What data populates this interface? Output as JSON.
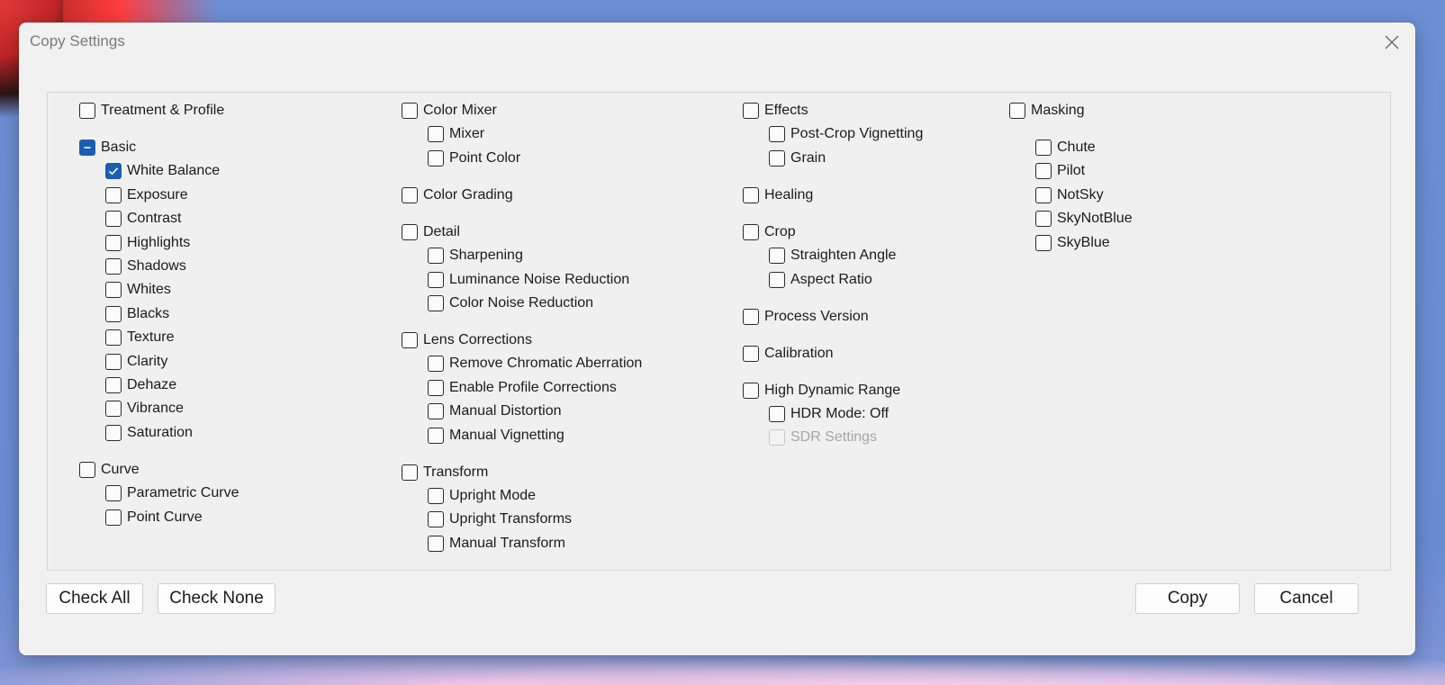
{
  "dialog": {
    "title": "Copy Settings"
  },
  "columns": [
    [
      {
        "label": "Treatment & Profile",
        "level": 0,
        "state": "unchecked",
        "gap": 0
      },
      {
        "label": "Basic",
        "level": 0,
        "state": "mixed",
        "gap": 1
      },
      {
        "label": "White Balance",
        "level": 1,
        "state": "checked"
      },
      {
        "label": "Exposure",
        "level": 1,
        "state": "unchecked"
      },
      {
        "label": "Contrast",
        "level": 1,
        "state": "unchecked"
      },
      {
        "label": "Highlights",
        "level": 1,
        "state": "unchecked"
      },
      {
        "label": "Shadows",
        "level": 1,
        "state": "unchecked"
      },
      {
        "label": "Whites",
        "level": 1,
        "state": "unchecked"
      },
      {
        "label": "Blacks",
        "level": 1,
        "state": "unchecked"
      },
      {
        "label": "Texture",
        "level": 1,
        "state": "unchecked"
      },
      {
        "label": "Clarity",
        "level": 1,
        "state": "unchecked"
      },
      {
        "label": "Dehaze",
        "level": 1,
        "state": "unchecked"
      },
      {
        "label": "Vibrance",
        "level": 1,
        "state": "unchecked"
      },
      {
        "label": "Saturation",
        "level": 1,
        "state": "unchecked"
      },
      {
        "label": "Curve",
        "level": 0,
        "state": "unchecked",
        "gap": 1
      },
      {
        "label": "Parametric Curve",
        "level": 1,
        "state": "unchecked"
      },
      {
        "label": "Point Curve",
        "level": 1,
        "state": "unchecked"
      }
    ],
    [
      {
        "label": "Color Mixer",
        "level": 0,
        "state": "unchecked",
        "gap": 0
      },
      {
        "label": "Mixer",
        "level": 1,
        "state": "unchecked"
      },
      {
        "label": "Point Color",
        "level": 1,
        "state": "unchecked"
      },
      {
        "label": "Color Grading",
        "level": 0,
        "state": "unchecked",
        "gap": 1
      },
      {
        "label": "Detail",
        "level": 0,
        "state": "unchecked",
        "gap": 1
      },
      {
        "label": "Sharpening",
        "level": 1,
        "state": "unchecked"
      },
      {
        "label": "Luminance Noise Reduction",
        "level": 1,
        "state": "unchecked"
      },
      {
        "label": "Color Noise Reduction",
        "level": 1,
        "state": "unchecked"
      },
      {
        "label": "Lens Corrections",
        "level": 0,
        "state": "unchecked",
        "gap": 1
      },
      {
        "label": "Remove Chromatic Aberration",
        "level": 1,
        "state": "unchecked"
      },
      {
        "label": "Enable Profile Corrections",
        "level": 1,
        "state": "unchecked"
      },
      {
        "label": "Manual Distortion",
        "level": 1,
        "state": "unchecked"
      },
      {
        "label": "Manual Vignetting",
        "level": 1,
        "state": "unchecked"
      },
      {
        "label": "Transform",
        "level": 0,
        "state": "unchecked",
        "gap": 1
      },
      {
        "label": "Upright Mode",
        "level": 1,
        "state": "unchecked"
      },
      {
        "label": "Upright Transforms",
        "level": 1,
        "state": "unchecked"
      },
      {
        "label": "Manual Transform",
        "level": 1,
        "state": "unchecked"
      }
    ],
    [
      {
        "label": "Effects",
        "level": 0,
        "state": "unchecked",
        "gap": 0
      },
      {
        "label": "Post-Crop Vignetting",
        "level": 1,
        "state": "unchecked"
      },
      {
        "label": "Grain",
        "level": 1,
        "state": "unchecked"
      },
      {
        "label": "Healing",
        "level": 0,
        "state": "unchecked",
        "gap": 1
      },
      {
        "label": "Crop",
        "level": 0,
        "state": "unchecked",
        "gap": 1
      },
      {
        "label": "Straighten Angle",
        "level": 1,
        "state": "unchecked"
      },
      {
        "label": "Aspect Ratio",
        "level": 1,
        "state": "unchecked"
      },
      {
        "label": "Process Version",
        "level": 0,
        "state": "unchecked",
        "gap": 1
      },
      {
        "label": "Calibration",
        "level": 0,
        "state": "unchecked",
        "gap": 1
      },
      {
        "label": "High Dynamic Range",
        "level": 0,
        "state": "unchecked",
        "gap": 1
      },
      {
        "label": "HDR Mode: Off",
        "level": 1,
        "state": "unchecked"
      },
      {
        "label": "SDR Settings",
        "level": 1,
        "state": "disabled"
      }
    ],
    [
      {
        "label": "Masking",
        "level": 0,
        "state": "unchecked",
        "gap": 0
      },
      {
        "label": "Chute",
        "level": 1,
        "state": "unchecked",
        "gap": 1
      },
      {
        "label": "Pilot",
        "level": 1,
        "state": "unchecked"
      },
      {
        "label": "NotSky",
        "level": 1,
        "state": "unchecked"
      },
      {
        "label": "SkyNotBlue",
        "level": 1,
        "state": "unchecked"
      },
      {
        "label": "SkyBlue",
        "level": 1,
        "state": "unchecked"
      }
    ]
  ],
  "buttons": {
    "check_all": "Check All",
    "check_none": "Check None",
    "copy": "Copy",
    "cancel": "Cancel"
  },
  "colors": {
    "accent": "#1a5fb4",
    "dialog_bg": "#f1f1f1"
  }
}
